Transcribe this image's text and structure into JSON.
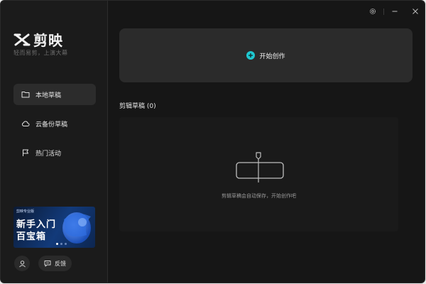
{
  "app": {
    "name": "剪映",
    "slogan": "轻而易剪，上演大幕"
  },
  "sidebar": {
    "items": [
      {
        "label": "本地草稿",
        "icon": "folder-icon",
        "active": true
      },
      {
        "label": "云备份草稿",
        "icon": "cloud-icon",
        "active": false
      },
      {
        "label": "热门活动",
        "icon": "flag-icon",
        "active": false
      }
    ],
    "banner": {
      "top_text": "剪映专业版",
      "line1": "新手入门",
      "line2": "百宝箱"
    },
    "feedback_label": "反馈"
  },
  "main": {
    "create_label": "开始创作",
    "drafts_title": "剪辑草稿 (0)",
    "empty_message": "剪辑草稿会自动保存，开始创作吧"
  },
  "colors": {
    "accent": "#1fc8d1",
    "background": "#161616",
    "card": "#2b2b2b"
  }
}
